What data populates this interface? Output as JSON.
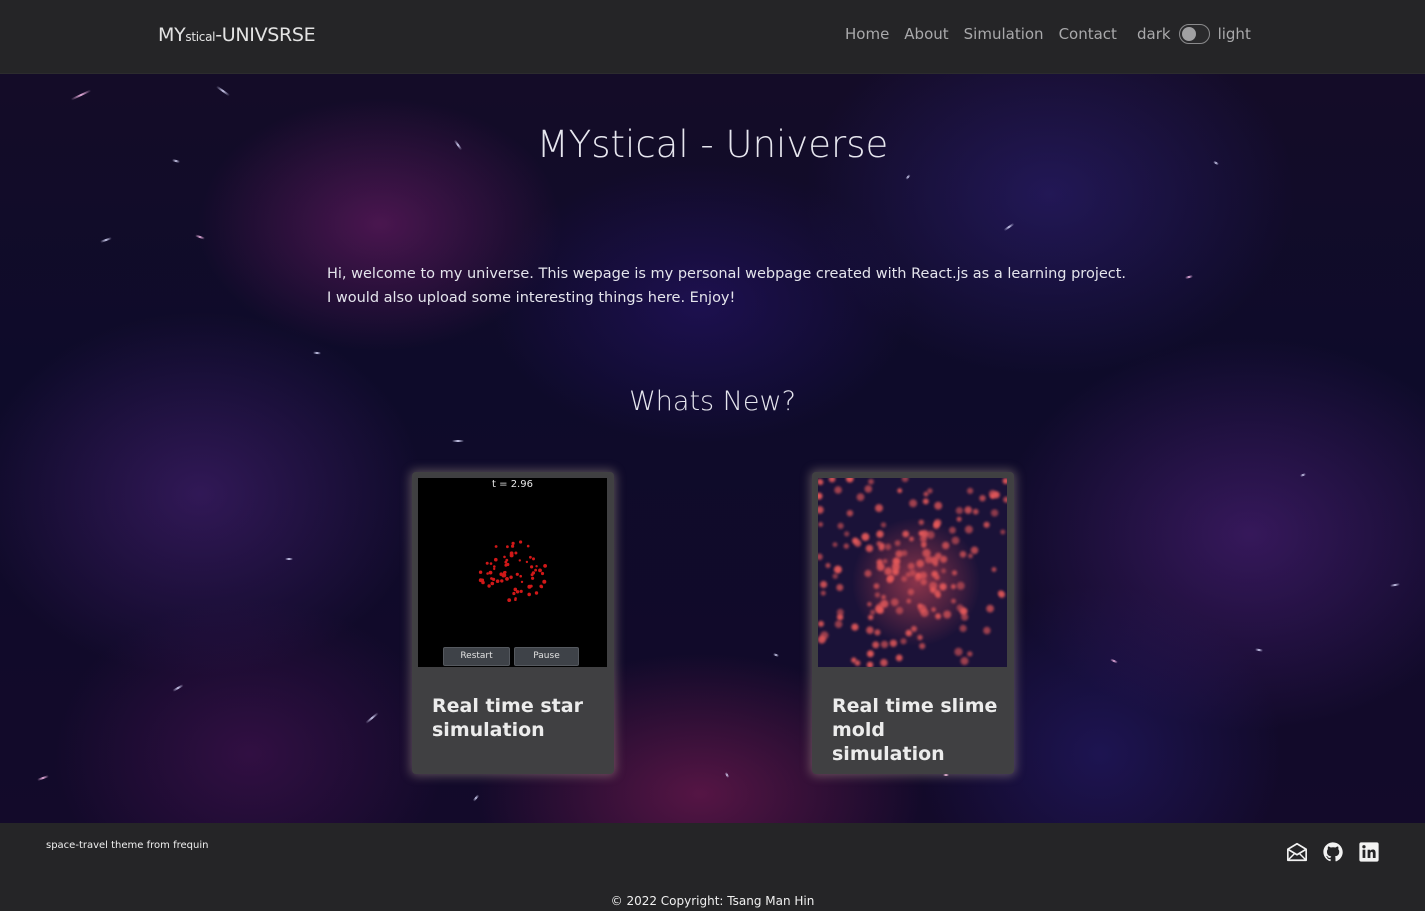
{
  "brand": {
    "prefix": "MY",
    "small": "stical",
    "suffix": "-UNIVSRSE"
  },
  "nav": {
    "links": [
      "Home",
      "About",
      "Simulation",
      "Contact"
    ],
    "theme": {
      "dark_label": "dark",
      "light_label": "light"
    }
  },
  "hero": {
    "title": "MYstical - Universe",
    "intro_line1": "Hi, welcome to my universe. This wepage is my personal webpage created with React.js as a learning project.",
    "intro_line2": "I would also upload some interesting things here. Enjoy!",
    "section_title": "Whats New?"
  },
  "cards": [
    {
      "title": "Real time star simulation",
      "time_label": "t = 2.96",
      "restart_label": "Restart",
      "pause_label": "Pause"
    },
    {
      "title": "Real time slime mold simulation"
    }
  ],
  "footer": {
    "credit": "space-travel theme from frequin",
    "copyright": "© 2022 Copyright: Tsang Man Hin",
    "icons": [
      "mail-icon",
      "github-icon",
      "linkedin-icon"
    ]
  },
  "colors": {
    "navbar_bg": "#252527",
    "card_bg": "#404042",
    "nav_text": "#a9a9ab",
    "star_particle": "#d01818",
    "slime_particle": "#e85a5a"
  }
}
